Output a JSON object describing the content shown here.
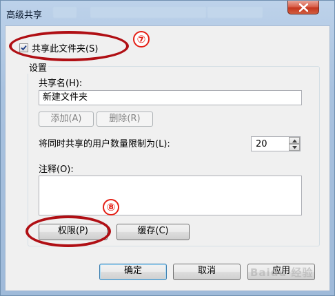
{
  "window": {
    "title": "高级共享"
  },
  "share_checkbox": {
    "label": "共享此文件夹(S)",
    "checked": true
  },
  "settings": {
    "group_label": "设置",
    "share_name_label": "共享名(H):",
    "share_name_value": "新建文件夹",
    "add_button": "添加(A)",
    "remove_button": "删除(R)",
    "user_limit_label": "将同时共享的用户数量限制为(L):",
    "user_limit_value": "20",
    "comment_label": "注释(O):",
    "comment_value": "",
    "permissions_button": "权限(P)",
    "caching_button": "缓存(C)"
  },
  "footer": {
    "ok_button": "确定",
    "cancel_button": "取消",
    "apply_button": "应用"
  },
  "annotations": {
    "step_7": "⑦",
    "step_8": "⑧",
    "color": "#e41e14"
  },
  "watermark": "Baidu 经验"
}
